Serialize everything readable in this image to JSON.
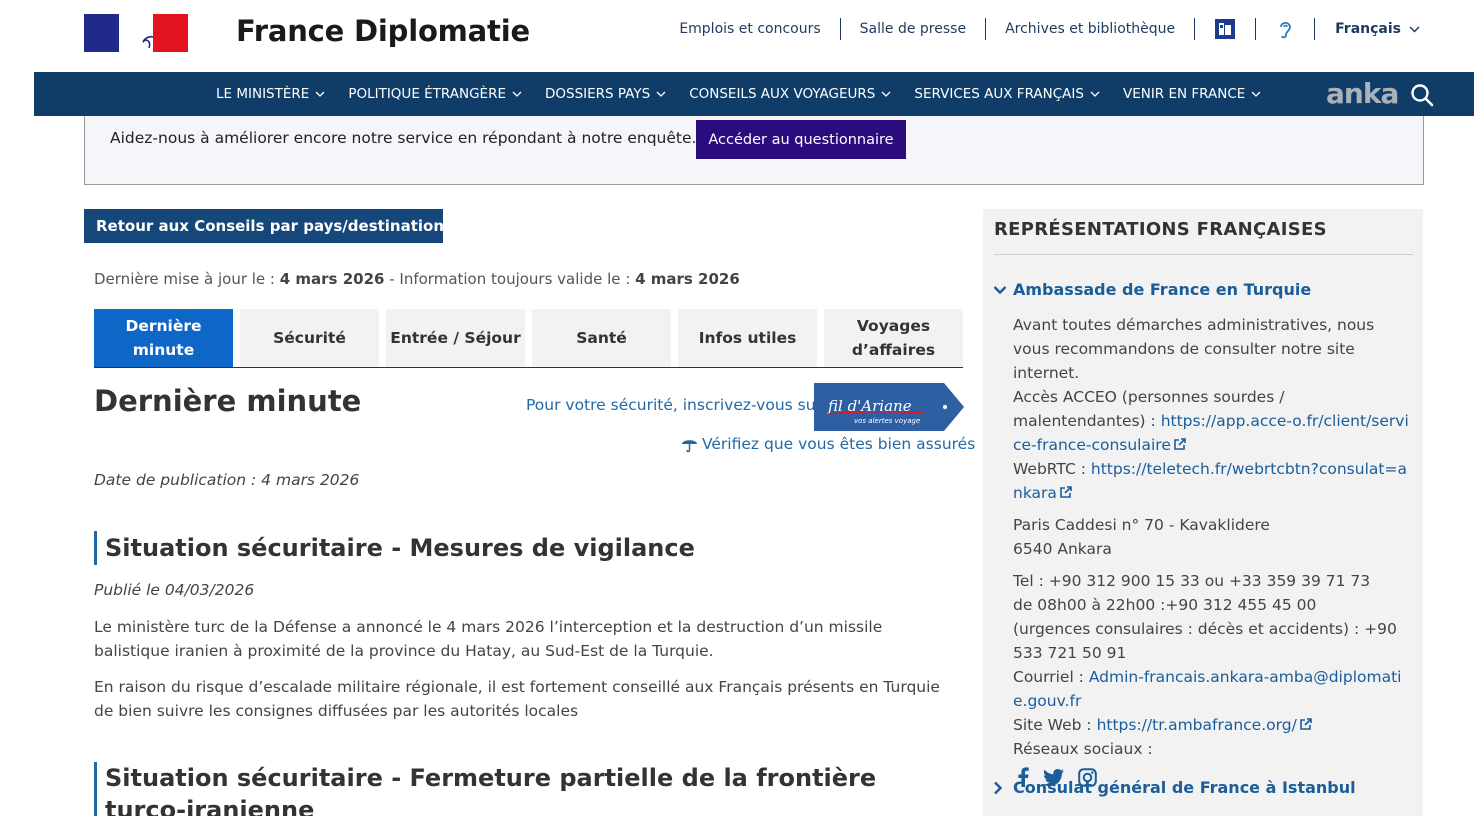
{
  "header": {
    "site_title": "France Diplomatie",
    "links": [
      "Emplois et concours",
      "Salle de presse",
      "Archives et bibliothèque"
    ],
    "language": "Français"
  },
  "nav": {
    "items": [
      "LE MINISTÈRE",
      "POLITIQUE ÉTRANGÈRE",
      "DOSSIERS PAYS",
      "CONSEILS AUX VOYAGEURS",
      "SERVICES AUX FRANÇAIS",
      "VENIR EN FRANCE"
    ],
    "watermark": "anka"
  },
  "survey": {
    "text": "Aidez-nous à améliorer encore notre service en répondant à notre enquête.",
    "button": "Accéder au questionnaire"
  },
  "back_button": "Retour aux Conseils par pays/destination",
  "update": {
    "label1": "Dernière mise à jour le : ",
    "date1": "4 mars 2026",
    "label2": " - Information toujours valide le : ",
    "date2": "4 mars 2026"
  },
  "tabs": [
    "Dernière minute",
    "Sécurité",
    "Entrée / Séjour",
    "Santé",
    "Infos utiles",
    "Voyages d’affaires"
  ],
  "main": {
    "title": "Dernière minute",
    "fil_link": "Pour votre sécurité, inscrivez-vous sur",
    "fil_badge_title": "fil d'Ariane",
    "fil_badge_sub": "vos alertes voyage",
    "assurance_link": "Vérifiez que vous êtes bien assurés",
    "pub_date": "Date de publication : 4 mars 2026",
    "sections": [
      {
        "title": "Situation sécuritaire - Mesures de vigilance",
        "published": "Publié le 04/03/2026",
        "paragraphs": [
          "Le ministère turc de la Défense a annoncé le 4 mars 2026 l’interception et la destruction d’un missile balistique iranien à proximité de la province du Hatay, au Sud-Est de la Turquie.",
          "En raison du risque d’escalade militaire régionale, il est fortement conseillé aux Français présents en Turquie de bien suivre les consignes diffusées par les autorités locales"
        ]
      },
      {
        "title": "Situation sécuritaire - Fermeture partielle de la frontière turco-iranienne"
      }
    ]
  },
  "sidebar": {
    "title": "REPRÉSENTATIONS FRANÇAISES",
    "embassy": {
      "name": "Ambassade de France en Turquie",
      "intro": "Avant toutes démarches administratives, nous vous recommandons de consulter notre site internet.",
      "acceo_label": "Accès ACCEO (personnes sourdes / malentendantes) : ",
      "acceo_url": "https://app.acce-o.fr/client/service-france-consulaire",
      "webrtc_label": "WebRTC : ",
      "webrtc_url": "https://teletech.fr/webrtcbtn?consulat=ankara",
      "address1": "Paris Caddesi n° 70 - Kavaklidere",
      "address2": "6540 Ankara",
      "tel1": "Tel : +90 312 900 15 33 ou +33 359 39 71 73",
      "tel2": "de 08h00 à 22h00 :+90 312 455 45 00",
      "tel3": "(urgences consulaires : décès et accidents) : +90 533 721 50 91",
      "mail_label": "Courriel : ",
      "mail": "Admin-francais.ankara-amba@diplomatie.gouv.fr",
      "web_label": "Site Web : ",
      "web_url": "https://tr.ambafrance.org/",
      "social_label": "Réseaux sociaux :"
    },
    "consulate": "Consulat général de France à Istanbul"
  }
}
